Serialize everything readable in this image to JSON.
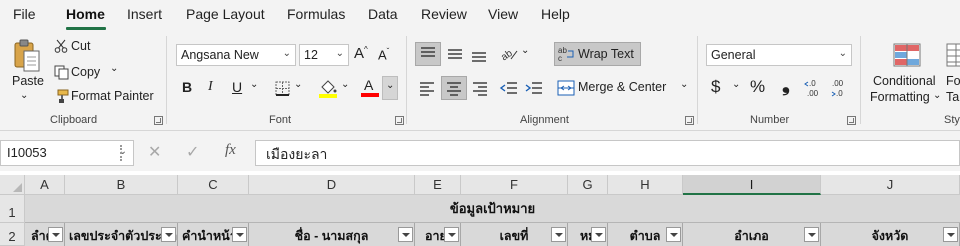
{
  "menu": {
    "tabs": [
      "File",
      "Home",
      "Insert",
      "Page Layout",
      "Formulas",
      "Data",
      "Review",
      "View",
      "Help"
    ],
    "active": "Home"
  },
  "clipboard": {
    "paste_label": "Paste",
    "cut_label": "Cut",
    "copy_label": "Copy",
    "format_painter_label": "Format Painter",
    "group_label": "Clipboard"
  },
  "font": {
    "font_name": "Angsana New",
    "font_size": "12",
    "bold": "B",
    "italic": "I",
    "underline": "U",
    "group_label": "Font",
    "fill_color": "#ffff00",
    "font_color": "#ff0000"
  },
  "alignment": {
    "wrap_text_label": "Wrap Text",
    "merge_center_label": "Merge & Center",
    "group_label": "Alignment"
  },
  "number": {
    "format": "General",
    "currency": "$",
    "percent": "%",
    "comma": "❟",
    "inc_decimal": "←.0\n.00",
    "dec_decimal": ".00\n→.0",
    "group_label": "Number"
  },
  "styles": {
    "conditional_label_1": "Conditional",
    "conditional_label_2": "Formatting",
    "format_as_label_1": "Fo",
    "format_as_label_2": "Ta",
    "group_label": "Sty"
  },
  "formula_bar": {
    "name_box": "I10053",
    "cancel": "✕",
    "enter": "✓",
    "fx": "fx",
    "content": "เมืองยะลา"
  },
  "grid": {
    "columns": [
      "A",
      "B",
      "C",
      "D",
      "E",
      "F",
      "G",
      "H",
      "I",
      "J"
    ],
    "selected_column": "I",
    "rows": [
      "1",
      "2"
    ],
    "merged_title": "ข้อมูลเป้าหมาย",
    "headers": [
      "ลำดั",
      "เลขประจำตัวประชาช",
      "คำนำหน้าชื่",
      "ชื่อ - นามสกุล",
      "อาย",
      "เลขที่",
      "หม",
      "ตำบล",
      "อำเภอ",
      "จังหวัด"
    ]
  },
  "colors": {
    "accent": "#217346"
  }
}
